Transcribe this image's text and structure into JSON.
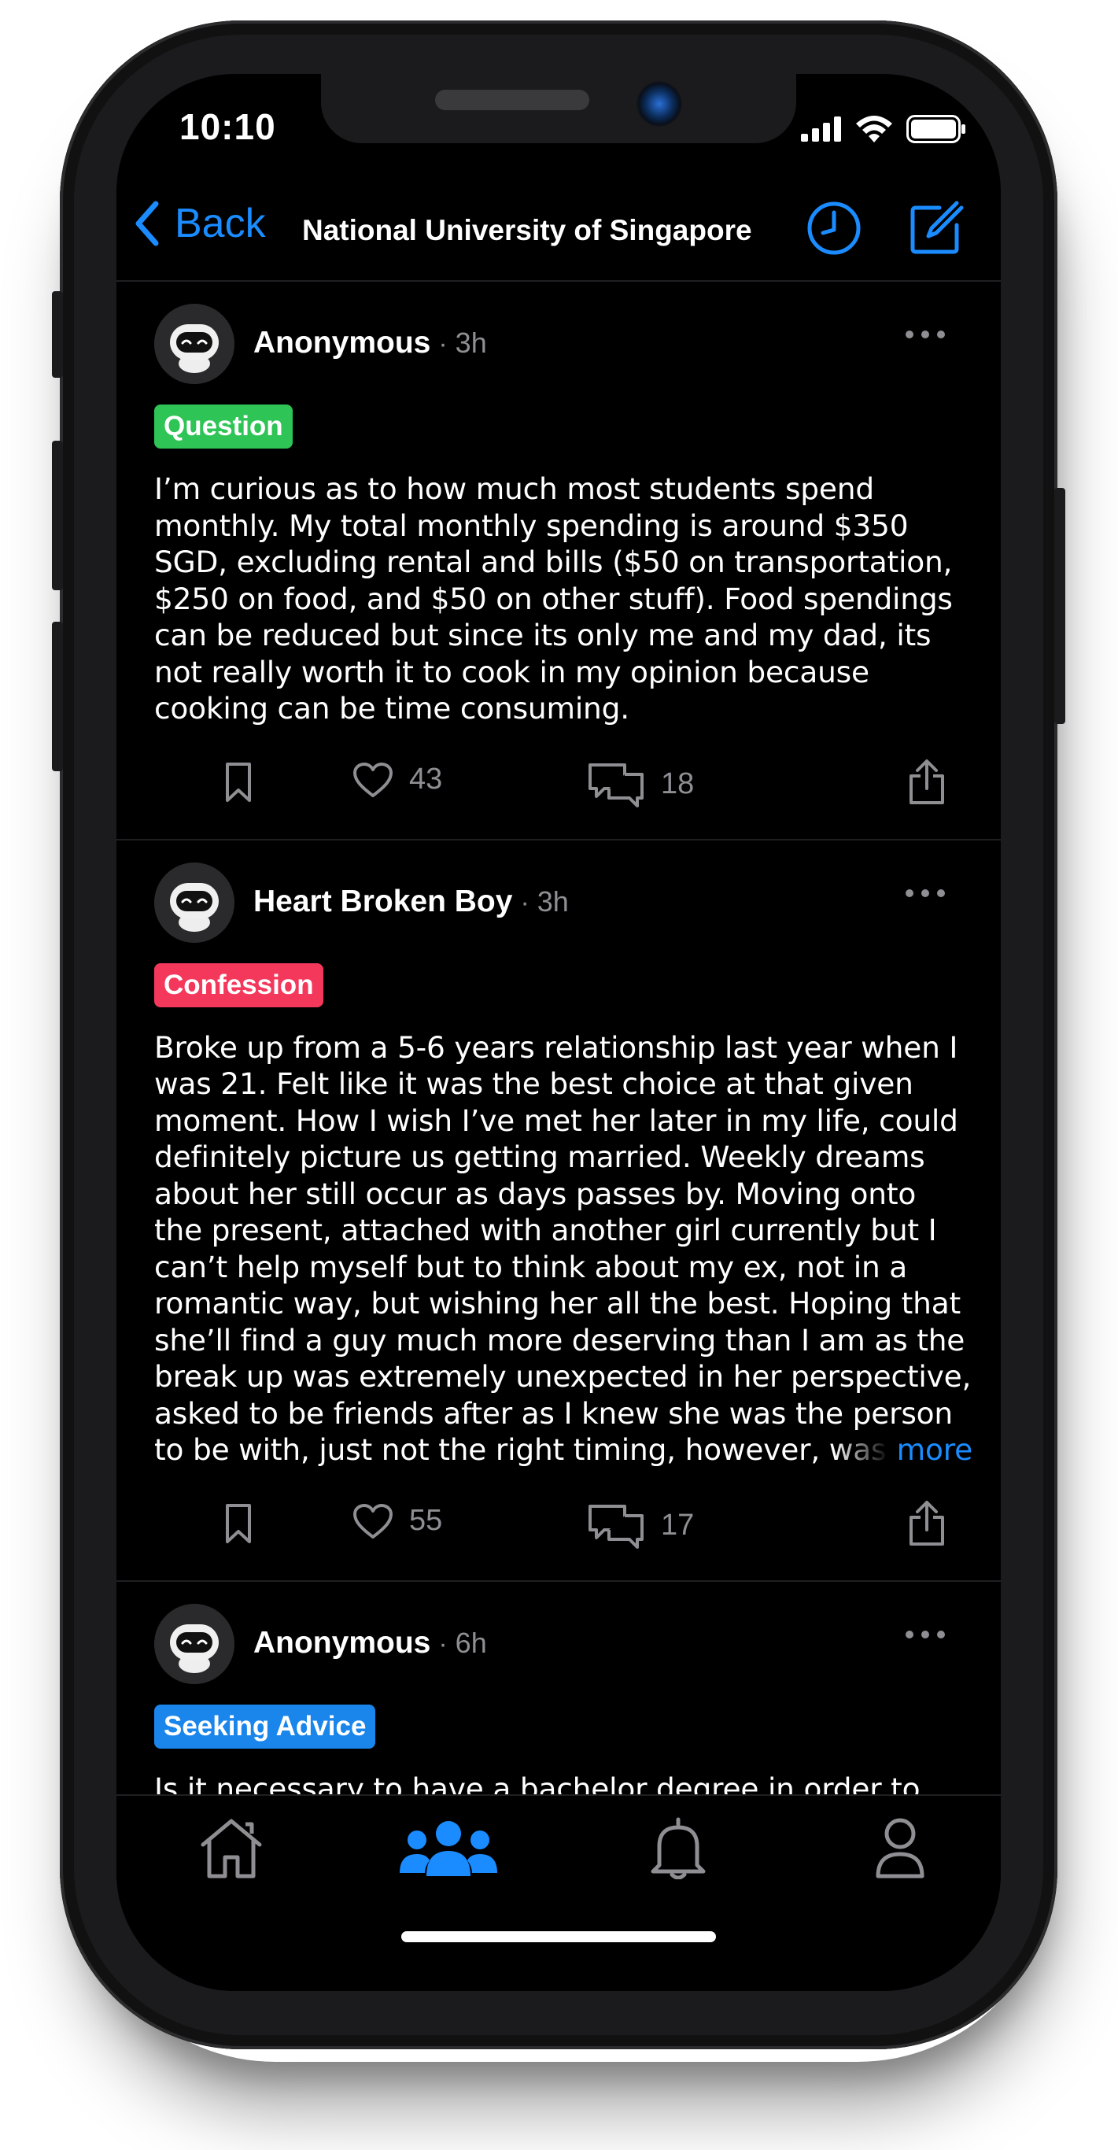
{
  "status": {
    "time": "10:10"
  },
  "nav": {
    "back_label": "Back",
    "title": "National University of Singapore"
  },
  "colors": {
    "accent": "#1a8cff",
    "question": "#2fc456",
    "confession": "#f4385c",
    "advice": "#1a86ec"
  },
  "posts": [
    {
      "author": "Anonymous",
      "time": "3h",
      "tag": "Question",
      "body": "I’m curious as to how much most students spend monthly. My total monthly spending is around $350 SGD, excluding rental and bills ($50 on transportation, $250 on food, and $50 on other stuff). Food spendings can be reduced but since its only me and my dad, its not really worth it to cook in my opinion because cooking can be time consuming.",
      "likes": "43",
      "comments": "18"
    },
    {
      "author": "Heart Broken Boy",
      "time": "3h",
      "tag": "Confession",
      "body": "Broke up from a 5-6 years relationship last year when I was 21. Felt like it was the best choice at that given moment. How I wish I’ve met her later in my life, could definitely picture us getting married. Weekly dreams about her still occur as days passes by. Moving onto the present, attached with another girl currently but I can’t help myself but to think about my ex, not in a romantic way, but wishing her all the best. Hoping that she’ll find a guy much more deserving than I am as the break up was extremely unexpected in her perspective, asked to be friends after as I knew she was the person to be with, just not the right timing, however, was declined, an",
      "more_label": "more",
      "likes": "55",
      "comments": "17"
    },
    {
      "author": "Anonymous",
      "time": "6h",
      "tag": "Seeking Advice",
      "body": "Is it necessary to have a bachelor degree in order to make it big in Singapore? What’s the truth? How far can"
    }
  ],
  "tabs": [
    {
      "icon": "home-icon",
      "active": false
    },
    {
      "icon": "community-icon",
      "active": true
    },
    {
      "icon": "bell-icon",
      "active": false
    },
    {
      "icon": "profile-icon",
      "active": false
    }
  ]
}
